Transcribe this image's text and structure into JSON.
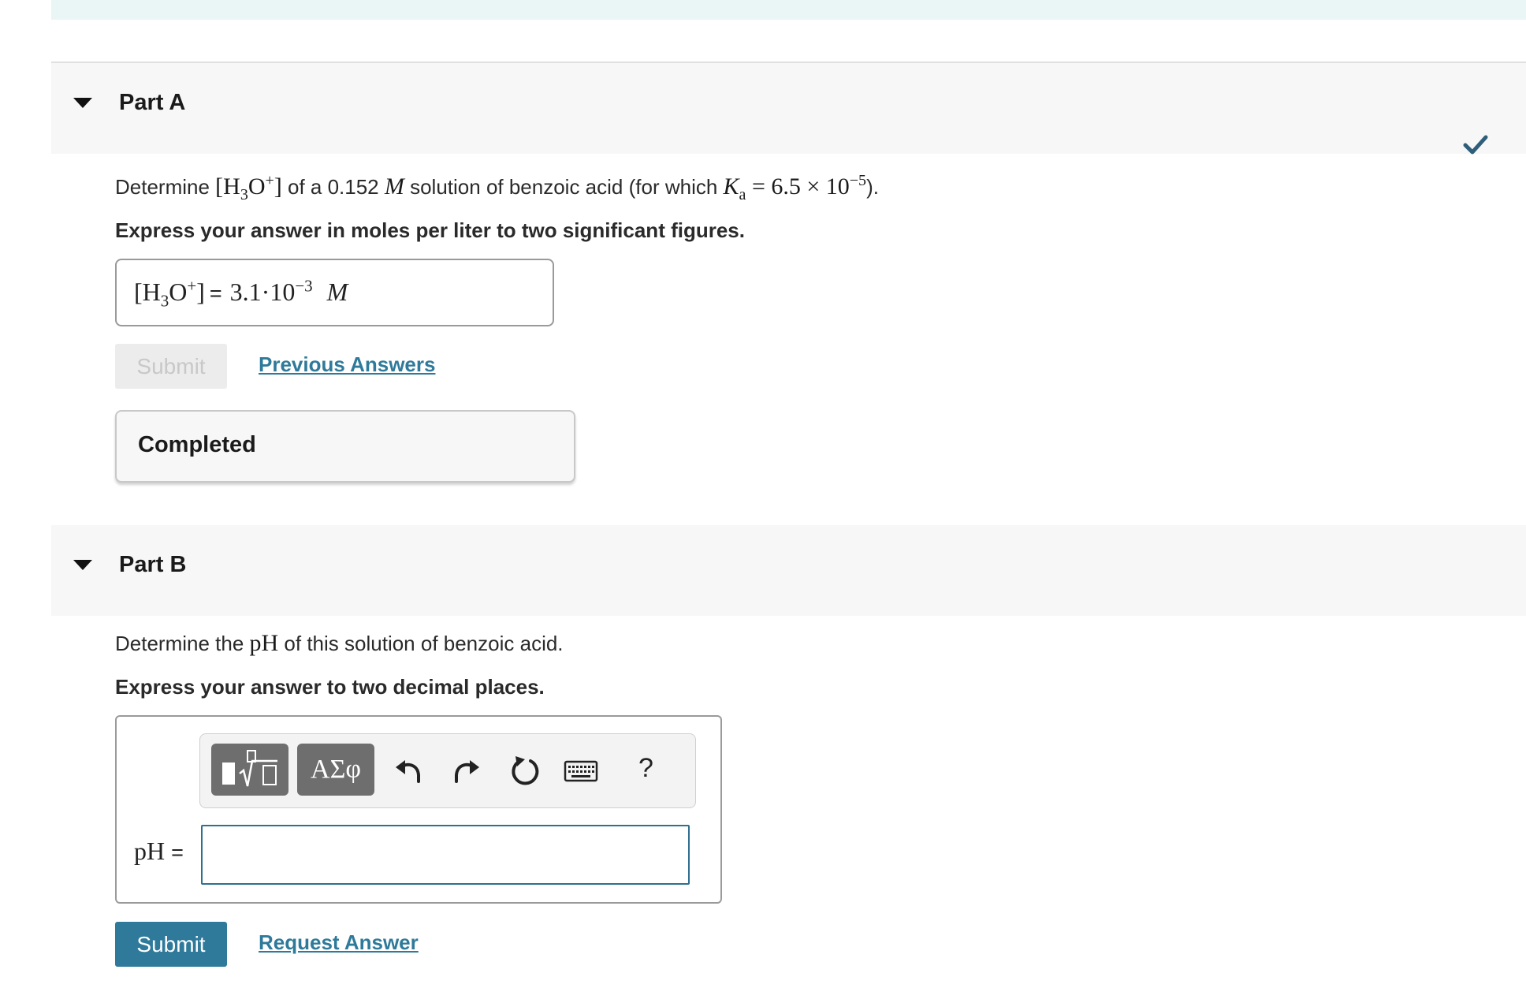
{
  "colors": {
    "accent": "#2f7a9a",
    "check": "#2f5e7a",
    "top_band": "#eaf6f6",
    "header_bg": "#f7f7f7"
  },
  "part_a": {
    "title": "Part A",
    "status_icon": "checkmark-icon",
    "prompt": {
      "lead": "Determine ",
      "ion_base": "[H",
      "ion_sub": "3",
      "ion_o": "O",
      "ion_sup": "+",
      "ion_close": "]",
      "text2": " of a 0.152 ",
      "unit_m": "M",
      "text3": " solution of benzoic acid (for which ",
      "ka_k": "K",
      "ka_sub": "a",
      "ka_eq": " = 6.5 × 10",
      "ka_exp": "−5",
      "tail": ")."
    },
    "instruction": "Express your answer in moles per liter to two significant figures.",
    "answer": {
      "ion_base": "[H",
      "ion_sub": "3",
      "ion_o": "O",
      "ion_sup": "+",
      "ion_close": "]",
      "equals": "=",
      "value": "3.1·10",
      "value_exp": "−3",
      "unit": "M"
    },
    "submit_label": "Submit",
    "previous_answers_label": "Previous Answers",
    "feedback": "Completed"
  },
  "part_b": {
    "title": "Part B",
    "prompt": {
      "lead": "Determine the ",
      "ph": "pH",
      "tail": " of this solution of benzoic acid."
    },
    "instruction": "Express your answer to two decimal places.",
    "toolbar": {
      "templates_icon": "templates-sqrt-icon",
      "greek_label": "ΑΣφ",
      "undo_icon": "undo-icon",
      "redo_icon": "redo-icon",
      "reset_icon": "reset-icon",
      "keyboard_icon": "keyboard-icon",
      "help_label": "?"
    },
    "answer_label": "pH",
    "answer_equals": "=",
    "answer_value": "",
    "submit_label": "Submit",
    "request_answer_label": "Request Answer"
  }
}
